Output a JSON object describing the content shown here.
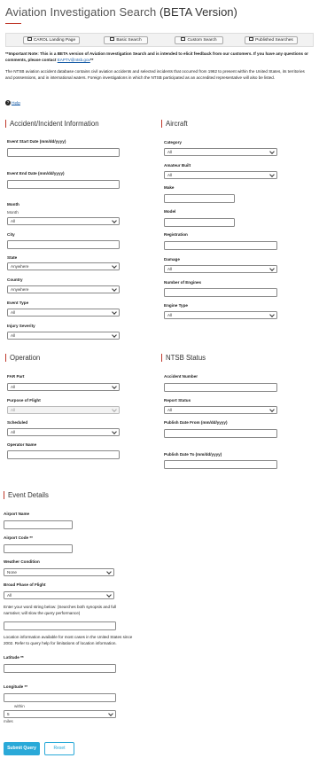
{
  "page": {
    "title_main": "Aviation Investigation Search",
    "title_suffix": "(BETA Version)"
  },
  "nav": {
    "carol": "CAROL Landing Page",
    "basic": "Basic Search",
    "custom": "Custom Search",
    "published": "Published Searches"
  },
  "notice": {
    "important_1": "**Important Note: This is a BETA version of Aviation Investigation Search and is intended to elicit feedback from our customers.  If you have any questions or comments, please contact ",
    "email": "EAPTV@ntsb.gov",
    "important_2": "**",
    "description": "The NTSB aviation accident database contains civil aviation accidents and selected incidents that occurred from 1962 to present within the United States, its territories and possessions, and in international waters. Foreign investigations in which the NTSB participated as an accredited representative will also be listed."
  },
  "help": "Help",
  "accident": {
    "heading": "Accident/Incident Information",
    "start_date": "Event Start Date (mm/dd/yyyy)",
    "end_date": "Event End Date (mm/dd/yyyy)",
    "month": "Month",
    "month_sub": "Month",
    "month_val": "All",
    "city": "City",
    "state": "State",
    "state_val": "Anywhere",
    "country": "Country",
    "country_val": "Anywhere",
    "event_type": "Event Type",
    "event_type_val": "All",
    "injury": "Injury Severity",
    "injury_val": "All"
  },
  "aircraft": {
    "heading": "Aircraft",
    "category": "Category",
    "category_val": "All",
    "amateur": "Amateur Built",
    "amateur_val": "All",
    "make": "Make",
    "model": "Model",
    "registration": "Registration",
    "damage": "Damage",
    "damage_val": "All",
    "engines": "Number of Engines",
    "engine_type": "Engine Type",
    "engine_type_val": "All"
  },
  "operation": {
    "heading": "Operation",
    "far": "FAR Part",
    "far_val": "All",
    "purpose": "Purpose of Flight",
    "purpose_val": "All",
    "scheduled": "Scheduled",
    "scheduled_val": "All",
    "operator": "Operator Name"
  },
  "ntsb": {
    "heading": "NTSB Status",
    "accident_number": "Accident Number",
    "report_status": "Report Status",
    "report_status_val": "All",
    "pub_from": "Publish Date From (mm/dd/yyyy)",
    "pub_to": "Publish Date To (mm/dd/yyyy)"
  },
  "event": {
    "heading": "Event Details",
    "airport_name": "Airport Name",
    "airport_code": "Airport Code **",
    "weather": "Weather Condition",
    "weather_val": "None",
    "phase": "Broad Phase of Flight",
    "phase_val": "All",
    "word_string": "Enter your word string below: (Searches both synopsis and full narrative; will slow the query performance)",
    "location_note": "Location information available for most cases in the United States since 2002. Refer to query help for limitations of location information.",
    "latitude": "Latitude **",
    "longitude": "Longitude **",
    "within": "within",
    "within_val": "5",
    "miles": "miles"
  },
  "buttons": {
    "submit": "Submit Query",
    "reset": "Reset"
  },
  "colors": {
    "accent": "#c0392b",
    "submit": "#2aa9d8",
    "link": "#1a5ea8"
  }
}
